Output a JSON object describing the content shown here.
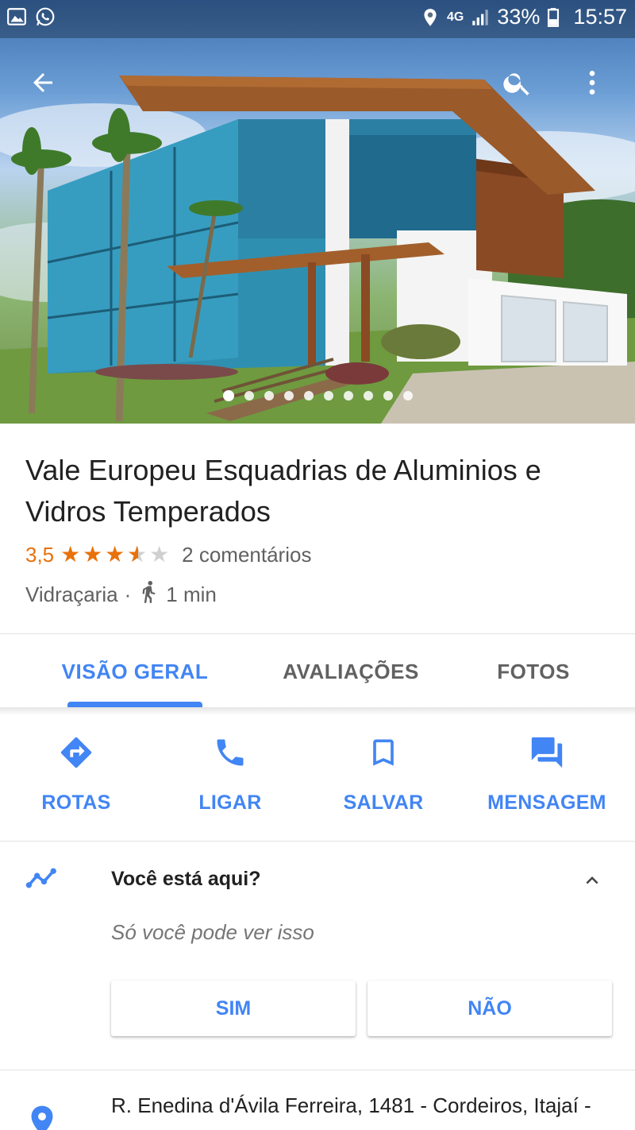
{
  "status_bar": {
    "left_icons": [
      "gallery-icon",
      "whatsapp-icon"
    ],
    "right_icons": [
      "location-icon",
      "4g-icon",
      "signal-icon",
      "battery-icon"
    ],
    "network": "4G",
    "battery": "33%",
    "time": "15:57"
  },
  "app_bar": {
    "icons": [
      "back-arrow-icon",
      "search-icon",
      "more-vert-icon"
    ]
  },
  "gallery": {
    "photo_count": 10,
    "current_index": 0
  },
  "place": {
    "name": "Vale Europeu Esquadrias de Aluminios e Vidros Temperados",
    "rating": "3,5",
    "rating_value": 3.5,
    "rating_max": 5,
    "reviews": "2 comentários",
    "category": "Vidraçaria",
    "separator": "·",
    "walk_time": "1 min"
  },
  "tabs": [
    {
      "label": "VISÃO GERAL",
      "active": true
    },
    {
      "label": "AVALIAÇÕES",
      "active": false
    },
    {
      "label": "FOTOS",
      "active": false
    }
  ],
  "actions": [
    {
      "label": "ROTAS",
      "icon": "directions-icon"
    },
    {
      "label": "LIGAR",
      "icon": "phone-icon"
    },
    {
      "label": "SALVAR",
      "icon": "bookmark-icon"
    },
    {
      "label": "MENSAGEM",
      "icon": "message-icon"
    }
  ],
  "question": {
    "title": "Você está aqui?",
    "subtitle": "Só você pode ver isso",
    "yes": "SIM",
    "no": "NÃO",
    "icon": "timeline-icon"
  },
  "address": {
    "text": "R. Enedina d'Ávila Ferreira, 1481 - Cordeiros, Itajaí -",
    "icon": "location-pin-icon"
  },
  "colors": {
    "accent": "#4285f4",
    "rating": "#e8710a",
    "text_primary": "#212121",
    "text_secondary": "#616161"
  }
}
